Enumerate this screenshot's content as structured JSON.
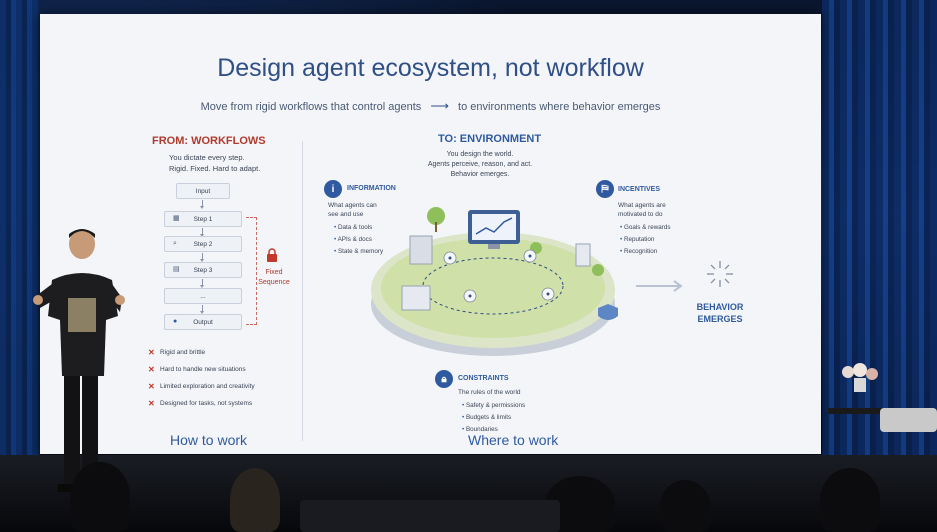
{
  "slide": {
    "title": "Design agent ecosystem, not workflow",
    "subtitle_left": "Move from rigid workflows that control agents",
    "subtitle_right": "to environments where behavior emerges"
  },
  "from": {
    "title": "FROM: WORKFLOWS",
    "line1": "You dictate every step.",
    "line2": "Rigid. Fixed. Hard to adapt.",
    "steps": [
      "Input",
      "Step 1",
      "Step 2",
      "Step 3",
      "...",
      "Output"
    ],
    "fixed_line1": "Fixed",
    "fixed_line2": "Sequence",
    "bullets": [
      "Rigid and brittle",
      "Hard to handle new situations",
      "Limited exploration and creativity",
      "Designed for tasks, not systems"
    ],
    "footer": "How to work"
  },
  "to": {
    "title": "TO: ENVIRONMENT",
    "line1": "You design the world.",
    "line2": "Agents perceive, reason, and act.",
    "line3": "Behavior emerges.",
    "information": {
      "head": "INFORMATION",
      "desc1": "What agents can",
      "desc2": "see and use",
      "items": [
        "Data & tools",
        "APIs & docs",
        "State & memory"
      ]
    },
    "incentives": {
      "head": "INCENTIVES",
      "desc1": "What agents are",
      "desc2": "motivated to do",
      "items": [
        "Goals & rewards",
        "Reputation",
        "Recognition"
      ]
    },
    "constraints": {
      "head": "CONSTRAINTS",
      "desc": "The rules of the world",
      "items": [
        "Safety & permissions",
        "Budgets & limits",
        "Boundaries"
      ]
    },
    "emerges_line1": "BEHAVIOR",
    "emerges_line2": "EMERGES",
    "footer": "Where to work"
  },
  "colors": {
    "accent_blue": "#2f5aa0",
    "title_blue": "#2f4f86",
    "warning_red": "#b03a2e"
  }
}
